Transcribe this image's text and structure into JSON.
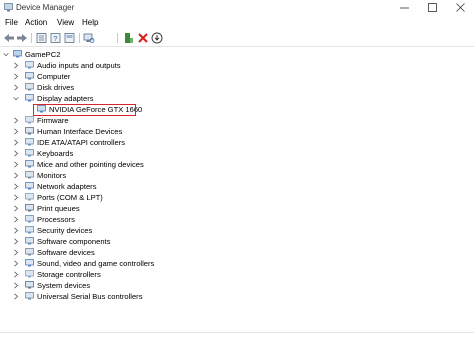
{
  "window": {
    "title": "Device Manager"
  },
  "menu": {
    "file": "File",
    "action": "Action",
    "view": "View",
    "help": "Help"
  },
  "tree": {
    "root": "GamePC2",
    "categories": [
      "Audio inputs and outputs",
      "Computer",
      "Disk drives",
      "Display adapters",
      "Firmware",
      "Human Interface Devices",
      "IDE ATA/ATAPI controllers",
      "Keyboards",
      "Mice and other pointing devices",
      "Monitors",
      "Network adapters",
      "Ports (COM & LPT)",
      "Print queues",
      "Processors",
      "Security devices",
      "Software components",
      "Software devices",
      "Sound, video and game controllers",
      "Storage controllers",
      "System devices",
      "Universal Serial Bus controllers"
    ],
    "display_adapter_child": "NVIDIA GeForce GTX 1660",
    "highlight_color": "#d9262a"
  },
  "icons": {
    "toolbar": [
      "back-arrow-icon",
      "forward-arrow-icon",
      "properties-icon",
      "help-icon",
      "scan-hardware-icon",
      "update-driver-icon",
      "uninstall-icon",
      "download-icon"
    ]
  }
}
